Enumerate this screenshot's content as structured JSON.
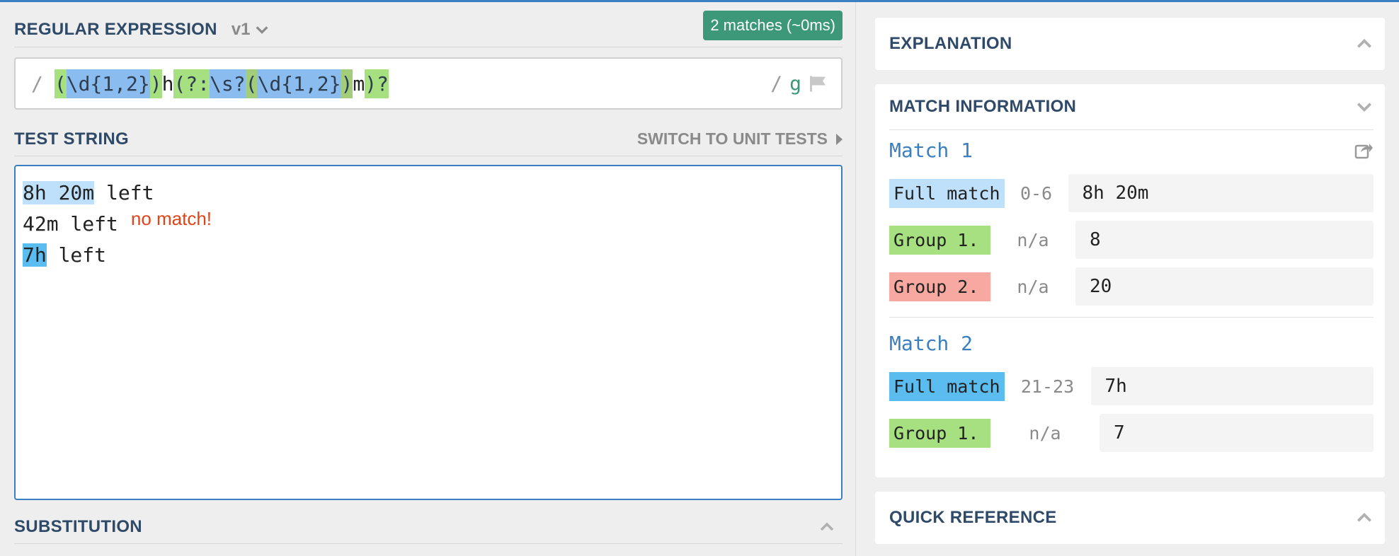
{
  "regex": {
    "title": "REGULAR EXPRESSION",
    "version": "v1",
    "match_badge": "2 matches (~0ms)",
    "delimiter_open": "/",
    "tokens": {
      "t1": "(",
      "t2": "\\d{1,2}",
      "t3": ")",
      "t4": "h",
      "t5": "(?:",
      "t6": "\\s?",
      "t7": "(",
      "t8": "\\d{1,2}",
      "t9": ")",
      "t10": "m",
      "t11": ")?"
    },
    "delimiter_close": "/",
    "flags": "g"
  },
  "test": {
    "title": "TEST STRING",
    "switch_label": "SWITCH TO UNIT TESTS",
    "line1_match": "8h 20m",
    "line1_rest": " left",
    "line2": "42m left",
    "line2_note": "no match!",
    "line3_match": "7h",
    "line3_rest": " left"
  },
  "substitution": {
    "title": "SUBSTITUTION"
  },
  "explanation": {
    "title": "EXPLANATION"
  },
  "match_info": {
    "title": "MATCH INFORMATION",
    "matches": [
      {
        "title": "Match 1",
        "rows": [
          {
            "label": "Full match",
            "range": "0-6",
            "value": "8h 20m"
          },
          {
            "label": "Group 1.",
            "range": "n/a",
            "value": "8"
          },
          {
            "label": "Group 2.",
            "range": "n/a",
            "value": "20"
          }
        ]
      },
      {
        "title": "Match 2",
        "rows": [
          {
            "label": "Full match",
            "range": "21-23",
            "value": "7h"
          },
          {
            "label": "Group 1.",
            "range": "n/a",
            "value": "7"
          }
        ]
      }
    ]
  },
  "quick_reference": {
    "title": "QUICK REFERENCE"
  },
  "colors": {
    "accent": "#3a7fbf",
    "badge": "#3c9878",
    "full_match_1": "#bfe0fb",
    "full_match_2": "#5bbcf0",
    "group1": "#a6e080",
    "group2": "#f7a8a0",
    "no_match": "#e0441b"
  },
  "icons": [
    "chevron-down-icon",
    "flag-icon",
    "triangle-right-icon",
    "chevron-up-icon",
    "share-icon"
  ]
}
